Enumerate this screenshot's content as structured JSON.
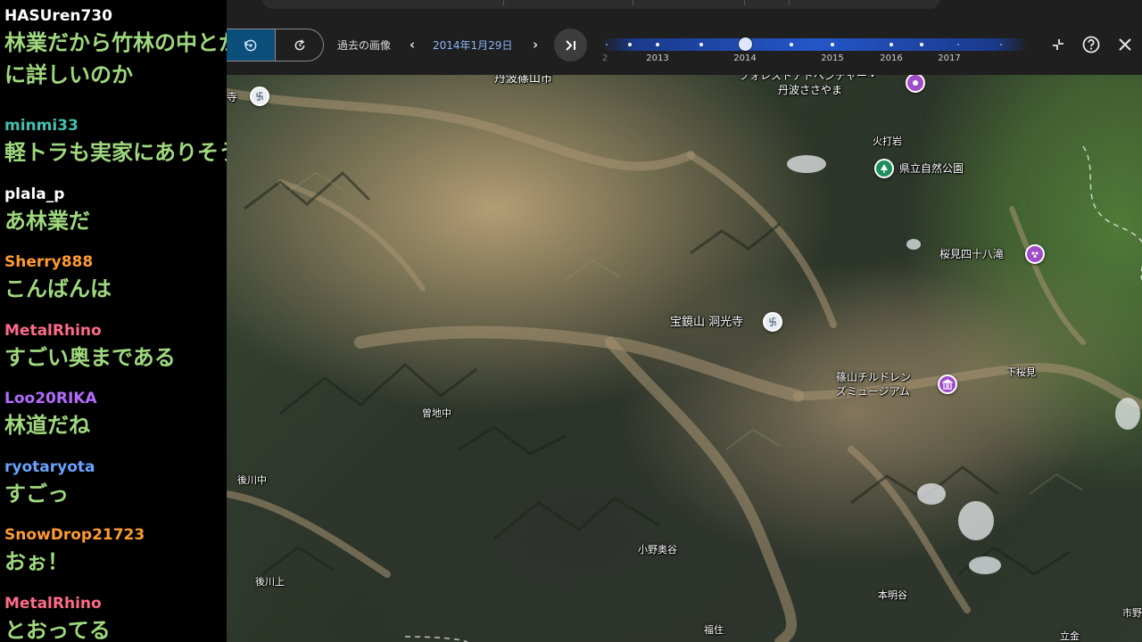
{
  "chat": {
    "messages": [
      {
        "user": "HASUren730",
        "color": "#ffffff",
        "text": "林業だから竹林の中とかに詳しいのか"
      },
      {
        "user": "minmi33",
        "color": "#44c0b0",
        "text": "軽トラも実家にありそう"
      },
      {
        "user": "plala_p",
        "color": "#ffffff",
        "text": "あ林業だ"
      },
      {
        "user": "Sherry888",
        "color": "#ff9b33",
        "text": "こんばんは"
      },
      {
        "user": "MetalRhino",
        "color": "#ff6b8b",
        "text": "すごい奥まである"
      },
      {
        "user": "Loo20RIKA",
        "color": "#b46cff",
        "text": "林道だね"
      },
      {
        "user": "ryotaryota",
        "color": "#6aa3ff",
        "text": "すごっ"
      },
      {
        "user": "SnowDrop21723",
        "color": "#ff9b33",
        "text": "おぉ！"
      },
      {
        "user": "MetalRhino",
        "color": "#ff6b8b",
        "text": "とおってる"
      }
    ]
  },
  "toolbar": {
    "history_label": "過去の画像",
    "date": "2014年1月29日",
    "prev_icon": "chevron-left-icon",
    "next_icon": "chevron-right-icon",
    "latest_icon": "skip-to-latest-icon",
    "collapse_icon": "collapse-icon",
    "help_icon": "help-icon",
    "close_icon": "close-icon"
  },
  "timeline": {
    "years": [
      "2013",
      "2014",
      "2015",
      "2016",
      "2017"
    ],
    "selected": "2014",
    "partial_left_label": "2"
  },
  "map": {
    "labels": {
      "tanbasasayama_city": "丹波篠山市",
      "forest_adventure": "フォレストアドベンチャー・",
      "forest_adventure_2": "丹波ささやま",
      "hiuchi": "火打岩",
      "nature_park": "県立自然公園",
      "sakurami": "桜見四十八滝",
      "hokyozan": "宝鏡山 洞光寺",
      "children_museum_1": "篠山チルドレン",
      "children_museum_2": "ズミュージアム",
      "shimosakurami": "下桜見",
      "sojinaka": "曽地中",
      "gokawanaka": "後川中",
      "gokawakami": "後川上",
      "onookudani": "小野奥谷",
      "honmyodani": "本明谷",
      "fukusumi": "福住",
      "ichino": "市野",
      "tera_left": "寺",
      "tachi": "立金"
    }
  }
}
